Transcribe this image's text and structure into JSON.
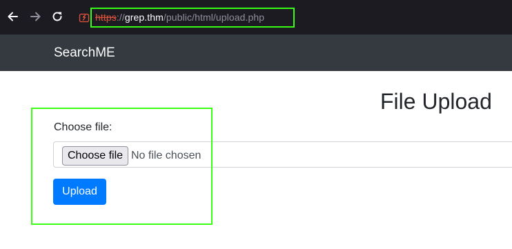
{
  "browser": {
    "url": {
      "scheme": "https",
      "separator": "://",
      "host": "grep.thm",
      "path": "/public/html/upload.php"
    },
    "icons": {
      "back": "arrow-left-icon",
      "forward": "arrow-right-icon",
      "reload": "reload-icon",
      "security": "broken-lock-icon"
    }
  },
  "navbar": {
    "brand": "SearchME"
  },
  "page": {
    "title": "File Upload",
    "form": {
      "label": "Choose file:",
      "file_button": "Choose file",
      "file_status": "No file chosen",
      "submit": "Upload"
    }
  },
  "colors": {
    "chrome_bg": "#1c1b22",
    "navbar_bg": "#343a40",
    "primary": "#007bff",
    "highlight": "#39ff14",
    "insecure": "#e2553b"
  }
}
